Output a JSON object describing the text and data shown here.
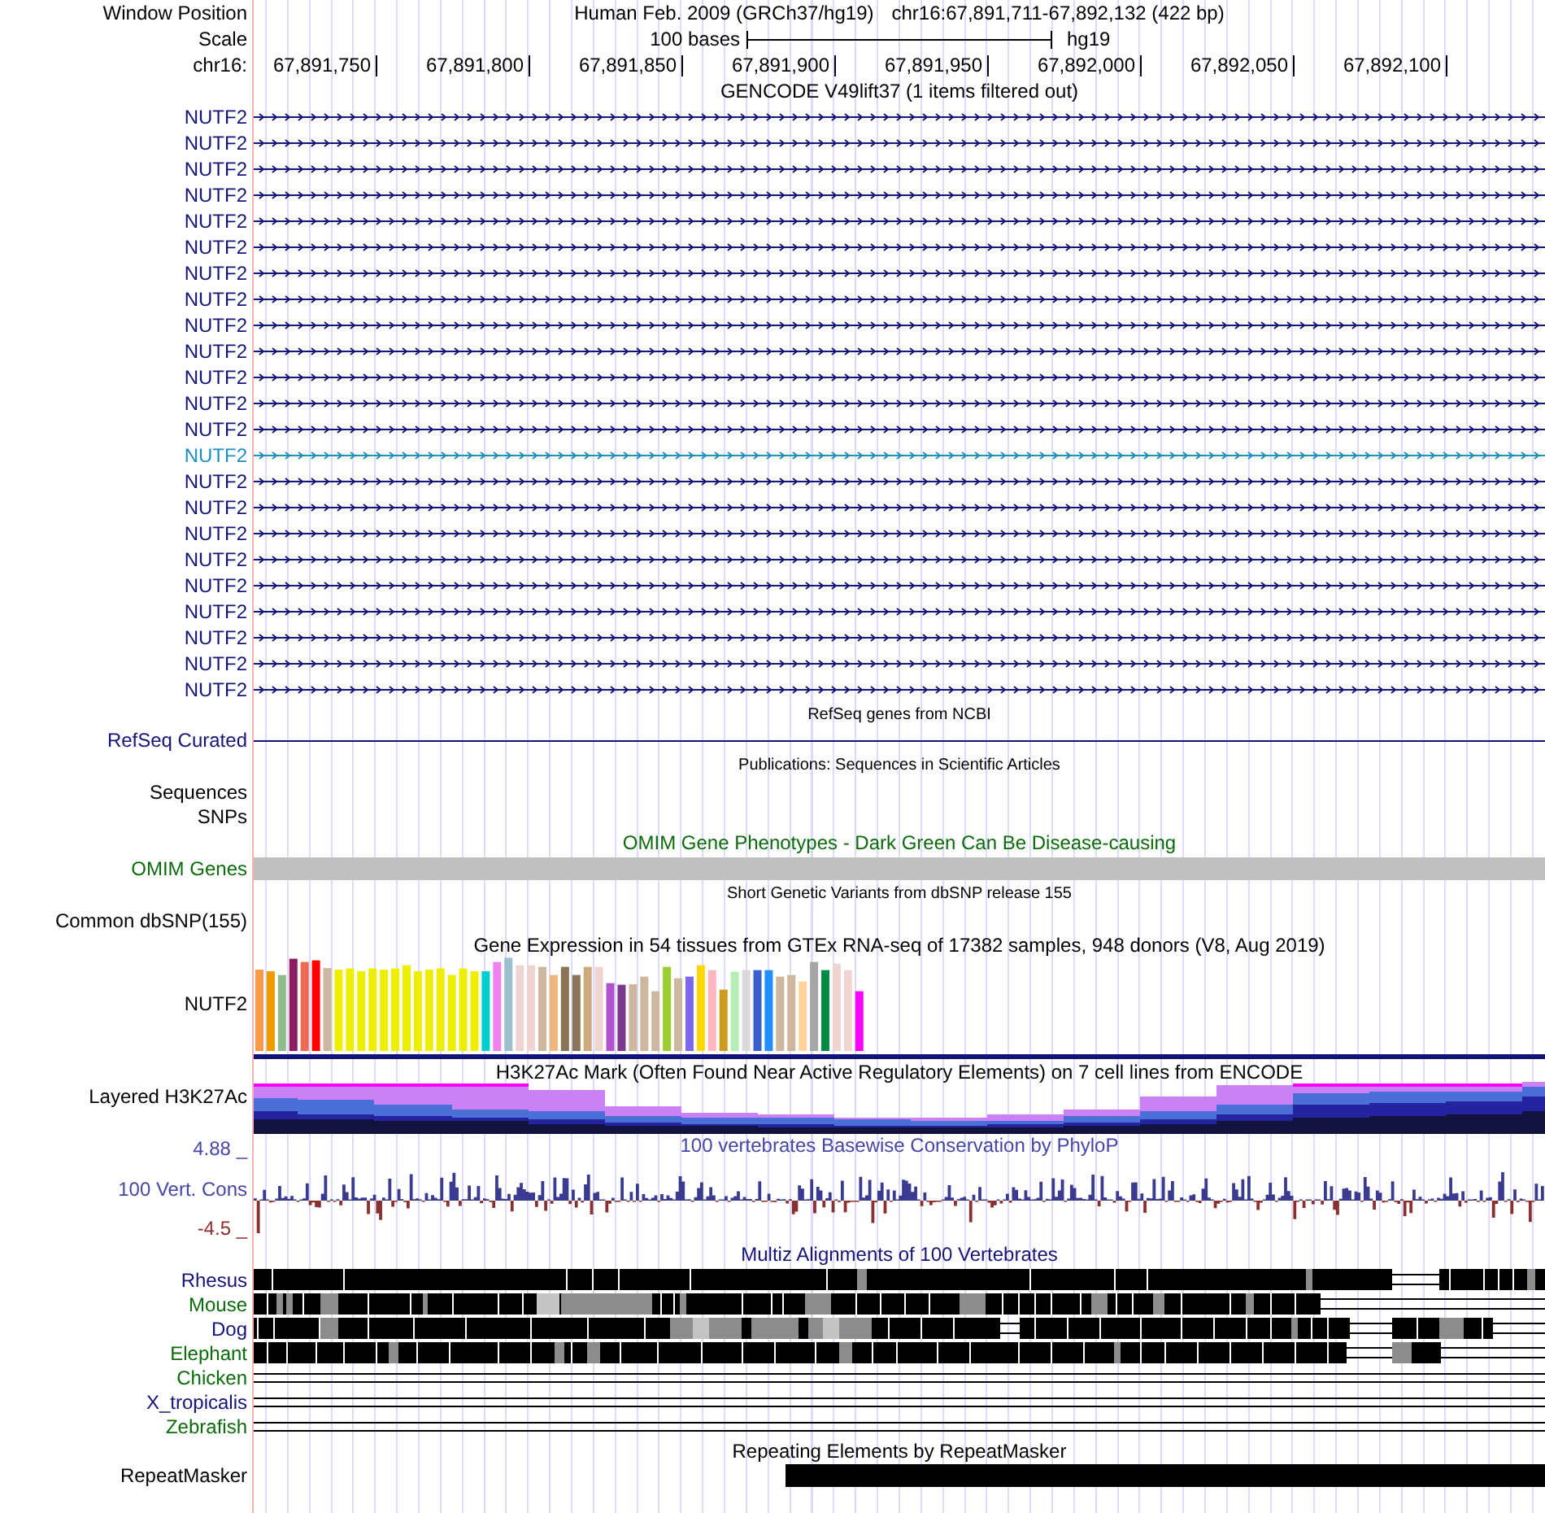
{
  "header": {
    "position_label": "Window Position",
    "assembly": "Human Feb. 2009 (GRCh37/hg19)",
    "position": "chr16:67,891,711-67,892,132 (422 bp)",
    "scale_label": "Scale",
    "scale_length": "100 bases",
    "scale_assembly": "hg19",
    "ruler_label": "chr16:",
    "ruler_ticks": [
      "67,891,750",
      "67,891,800",
      "67,891,850",
      "67,891,900",
      "67,891,950",
      "67,892,000",
      "67,892,050",
      "67,892,100"
    ]
  },
  "tracks": [
    {
      "kind": "transcripts",
      "title": {
        "text": "GENCODE V49lift37 (1 items filtered out)",
        "color": "#000000"
      },
      "items": [
        {
          "label": "NUTF2",
          "color": "#141478"
        },
        {
          "label": "NUTF2",
          "color": "#141478"
        },
        {
          "label": "NUTF2",
          "color": "#141478"
        },
        {
          "label": "NUTF2",
          "color": "#141478"
        },
        {
          "label": "NUTF2",
          "color": "#141478"
        },
        {
          "label": "NUTF2",
          "color": "#141478"
        },
        {
          "label": "NUTF2",
          "color": "#141478"
        },
        {
          "label": "NUTF2",
          "color": "#141478"
        },
        {
          "label": "NUTF2",
          "color": "#141478"
        },
        {
          "label": "NUTF2",
          "color": "#141478"
        },
        {
          "label": "NUTF2",
          "color": "#141478"
        },
        {
          "label": "NUTF2",
          "color": "#141478"
        },
        {
          "label": "NUTF2",
          "color": "#141478"
        },
        {
          "label": "NUTF2",
          "color": "#1e8fbf"
        },
        {
          "label": "NUTF2",
          "color": "#141478"
        },
        {
          "label": "NUTF2",
          "color": "#141478"
        },
        {
          "label": "NUTF2",
          "color": "#141478"
        },
        {
          "label": "NUTF2",
          "color": "#141478"
        },
        {
          "label": "NUTF2",
          "color": "#141478"
        },
        {
          "label": "NUTF2",
          "color": "#141478"
        },
        {
          "label": "NUTF2",
          "color": "#141478"
        },
        {
          "label": "NUTF2",
          "color": "#141478"
        },
        {
          "label": "NUTF2",
          "color": "#141478"
        }
      ]
    },
    {
      "kind": "line",
      "title": {
        "text": "RefSeq genes from NCBI",
        "color": "#000000"
      },
      "label": "RefSeq Curated",
      "color": "#141478"
    },
    {
      "kind": "labels",
      "title": {
        "text": "Publications: Sequences in Scientific Articles",
        "color": "#000000"
      },
      "labels": [
        "Sequences",
        "SNPs"
      ],
      "color": "#000000"
    },
    {
      "kind": "bar",
      "title": {
        "text": "OMIM Gene Phenotypes - Dark Green Can Be Disease-causing",
        "color": "#0b6b0b"
      },
      "label": "OMIM Genes",
      "color": "#0b6b0b"
    },
    {
      "kind": "labels",
      "title": {
        "text": "Short Genetic Variants from dbSNP release 155",
        "color": "#000000"
      },
      "labels": [
        "Common dbSNP(155)"
      ],
      "color": "#000000"
    },
    {
      "kind": "expression",
      "title": {
        "text": "Gene Expression in 54 tissues from GTEx RNA-seq of 17382 samples, 948 donors (V8, Aug 2019)",
        "color": "#000000"
      },
      "label": "NUTF2",
      "color": "#000000"
    },
    {
      "kind": "layered",
      "title": {
        "text": "H3K27Ac Mark (Often Found Near Active Regulatory Elements) on 7 cell lines from ENCODE",
        "color": "#000000"
      },
      "label": "Layered H3K27Ac",
      "color": "#000000"
    },
    {
      "kind": "conservation",
      "title": {
        "text": "100 vertebrates Basewise Conservation by PhyloP",
        "color": "#4646a6"
      },
      "label": "100 Vert. Cons",
      "color": "#4646a6",
      "max_label": "4.88 _",
      "min_label": "-4.5 _"
    },
    {
      "kind": "alignment",
      "title": {
        "text": "Multiz Alignments of 100 Vertebrates",
        "color": "#141478"
      },
      "species": [
        {
          "label": "Rhesus",
          "color": "#141478",
          "kind": "blocks"
        },
        {
          "label": "Mouse",
          "color": "#0b6b0b",
          "kind": "blocks"
        },
        {
          "label": "Dog",
          "color": "#141478",
          "kind": "blocks"
        },
        {
          "label": "Elephant",
          "color": "#0b6b0b",
          "kind": "blocks"
        },
        {
          "label": "Chicken",
          "color": "#0b6b0b",
          "kind": "gap"
        },
        {
          "label": "X_tropicalis",
          "color": "#141478",
          "kind": "gap"
        },
        {
          "label": "Zebrafish",
          "color": "#0b6b0b",
          "kind": "gap"
        }
      ]
    },
    {
      "kind": "repeats",
      "title": {
        "text": "Repeating Elements by RepeatMasker",
        "color": "#000000"
      },
      "label": "RepeatMasker",
      "color": "#000000"
    }
  ]
}
